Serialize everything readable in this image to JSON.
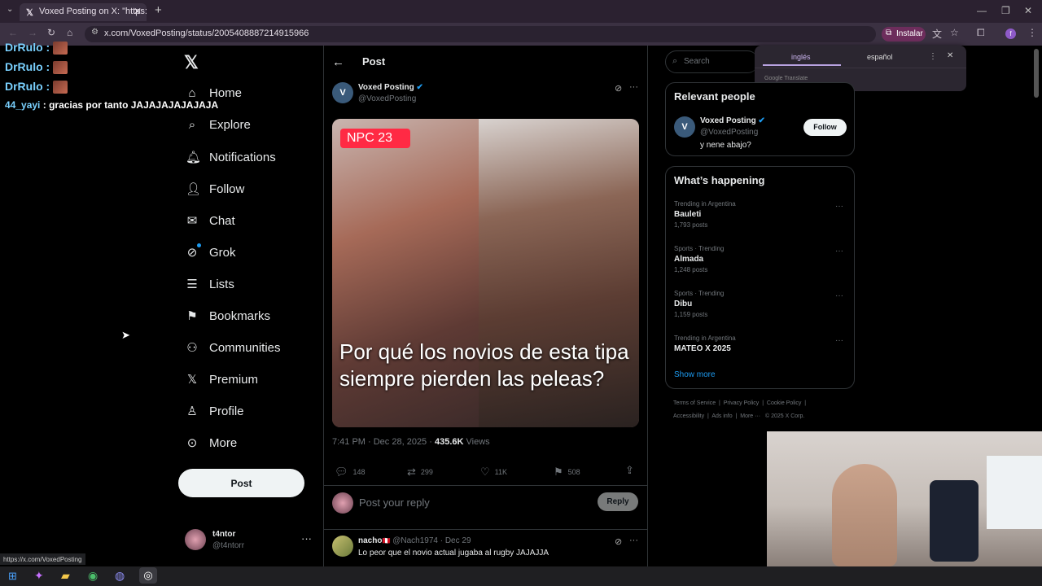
{
  "browser": {
    "tab_title": "Voxed Posting on X: \"https://t.c",
    "url": "x.com/VoxedPosting/status/2005408887214915966",
    "install_label": "Instalar",
    "status_url": "https://x.com/VoxedPosting"
  },
  "translate": {
    "lang_source": "inglés",
    "lang_target": "español",
    "brand": "Google Translate"
  },
  "chat": [
    {
      "user": "DrRulo :",
      "msg": ""
    },
    {
      "user": "DrRulo :",
      "msg": ""
    },
    {
      "user": "DrRulo :",
      "msg": ""
    },
    {
      "user": "44_yayi",
      "msg": ": gracias por tanto JAJAJAJAJAJAJA"
    }
  ],
  "nav": [
    "Home",
    "Explore",
    "Notifications",
    "Follow",
    "Chat",
    "Grok",
    "Lists",
    "Bookmarks",
    "Communities",
    "Premium",
    "Profile",
    "More"
  ],
  "post_button": "Post",
  "account": {
    "name": "t4ntor",
    "handle": "@t4ntorr"
  },
  "header": {
    "title": "Post"
  },
  "tweet": {
    "author": "Voxed Posting",
    "handle": "@VoxedPosting",
    "badge": "NPC 23",
    "caption": "Por qué los novios de esta tipa siempre pierden las peleas?",
    "time": "7:41 PM · Dec 28, 2025 ·",
    "views_count": "435.6K",
    "views_label": "Views",
    "replies": "148",
    "reposts": "299",
    "likes": "11K",
    "bookmarks": "508"
  },
  "reply_box": {
    "placeholder": "Post your reply",
    "button": "Reply"
  },
  "reply": {
    "author": "nacho",
    "meta": "@Nach1974 · Dec 29",
    "text": "Lo peor que el novio actual jugaba al rugby JAJAJJA"
  },
  "search": {
    "placeholder": "Search"
  },
  "relevant": {
    "title": "Relevant people",
    "name": "Voxed Posting",
    "handle": "@VoxedPosting",
    "bio": "y nene abajo?",
    "follow": "Follow"
  },
  "trending": {
    "title": "What’s happening",
    "items": [
      {
        "meta": "Trending in Argentina",
        "name": "Bauleti",
        "posts": "1,793 posts"
      },
      {
        "meta": "Sports · Trending",
        "name": "Almada",
        "posts": "1,248 posts"
      },
      {
        "meta": "Sports · Trending",
        "name": "Dibu",
        "posts": "1,159 posts"
      },
      {
        "meta": "Trending in Argentina",
        "name": "MATEO X 2025",
        "posts": ""
      }
    ],
    "show_more": "Show more"
  },
  "footer": {
    "row1": [
      "Terms of Service",
      "Privacy Policy",
      "Cookie Policy"
    ],
    "row2": [
      "Accessibility",
      "Ads info",
      "More ···",
      "© 2025 X Corp."
    ]
  },
  "colors": {
    "accent": "#1d9bf0",
    "background": "#000000",
    "border": "#2f3336",
    "muted": "#71767b"
  }
}
